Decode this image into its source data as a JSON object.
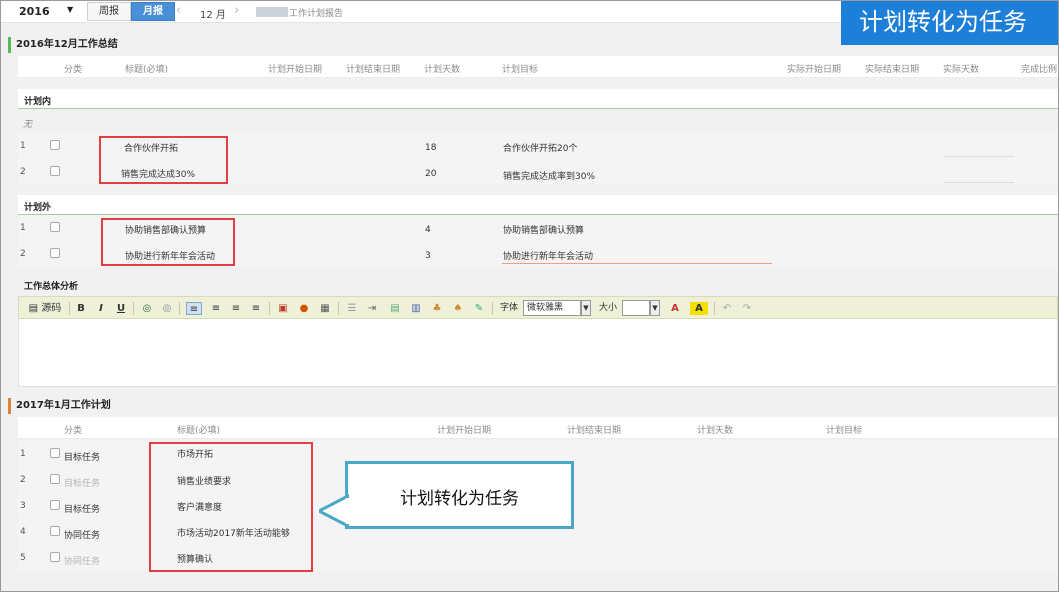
{
  "top": {
    "year": "2016",
    "week_label": "周报",
    "month_label": "月报",
    "prev": "‹",
    "month_value": "12 月",
    "next": "›",
    "report_title": "工作计划报告"
  },
  "banner": "计划转化为任务",
  "summary": {
    "title": "2016年12月工作总结",
    "headers": [
      "分类",
      "标题(必填)",
      "计划开始日期",
      "计划结束日期",
      "计划天数",
      "计划目标",
      "实际开始日期",
      "实际结束日期",
      "实际天数",
      "完成比例"
    ],
    "in_plan_label": "计划内",
    "none_text": "无",
    "in_plan_rows": [
      {
        "no": "1",
        "title": "合作伙伴开拓",
        "days": "18",
        "goal": "合作伙伴开拓20个"
      },
      {
        "no": "2",
        "title": "销售完成达成30%",
        "days": "20",
        "goal": "销售完成达成率到30%"
      }
    ],
    "out_plan_label": "计划外",
    "out_plan_rows": [
      {
        "no": "1",
        "title": "协助销售部确认预算",
        "days": "4",
        "goal": "协助销售部确认预算"
      },
      {
        "no": "2",
        "title": "协助进行新年年会活动",
        "days": "3",
        "goal": "协助进行新年年会活动"
      }
    ]
  },
  "editor": {
    "label": "工作总体分析",
    "source_label": "源码",
    "bold": "B",
    "italic": "I",
    "underline": "U",
    "font_label": "字体",
    "font_value": "微软雅黑",
    "size_label": "大小",
    "size_value": "",
    "font_color": "A",
    "bg_color": "A",
    "undo": "↶",
    "redo": "↷"
  },
  "plan": {
    "title": "2017年1月工作计划",
    "headers": [
      "分类",
      "标题(必填)",
      "计划开始日期",
      "计划结束日期",
      "计划天数",
      "计划目标"
    ],
    "rows": [
      {
        "no": "1",
        "category": "目标任务",
        "title": "市场开拓",
        "muted": false
      },
      {
        "no": "2",
        "category": "目标任务",
        "title": "销售业绩要求",
        "muted": true
      },
      {
        "no": "3",
        "category": "目标任务",
        "title": "客户满意度",
        "muted": false
      },
      {
        "no": "4",
        "category": "协同任务",
        "title": "市场活动2017新年活动能够",
        "muted": false
      },
      {
        "no": "5",
        "category": "协同任务",
        "title": "预算确认",
        "muted": true
      }
    ]
  },
  "callout": "计划转化为任务",
  "colors": {
    "accent": "#1e7fd8",
    "section1_bar": "#5cb85c",
    "section2_bar": "#d9843b",
    "highlight_box": "#e04040",
    "callout_border": "#4aa8c4"
  }
}
